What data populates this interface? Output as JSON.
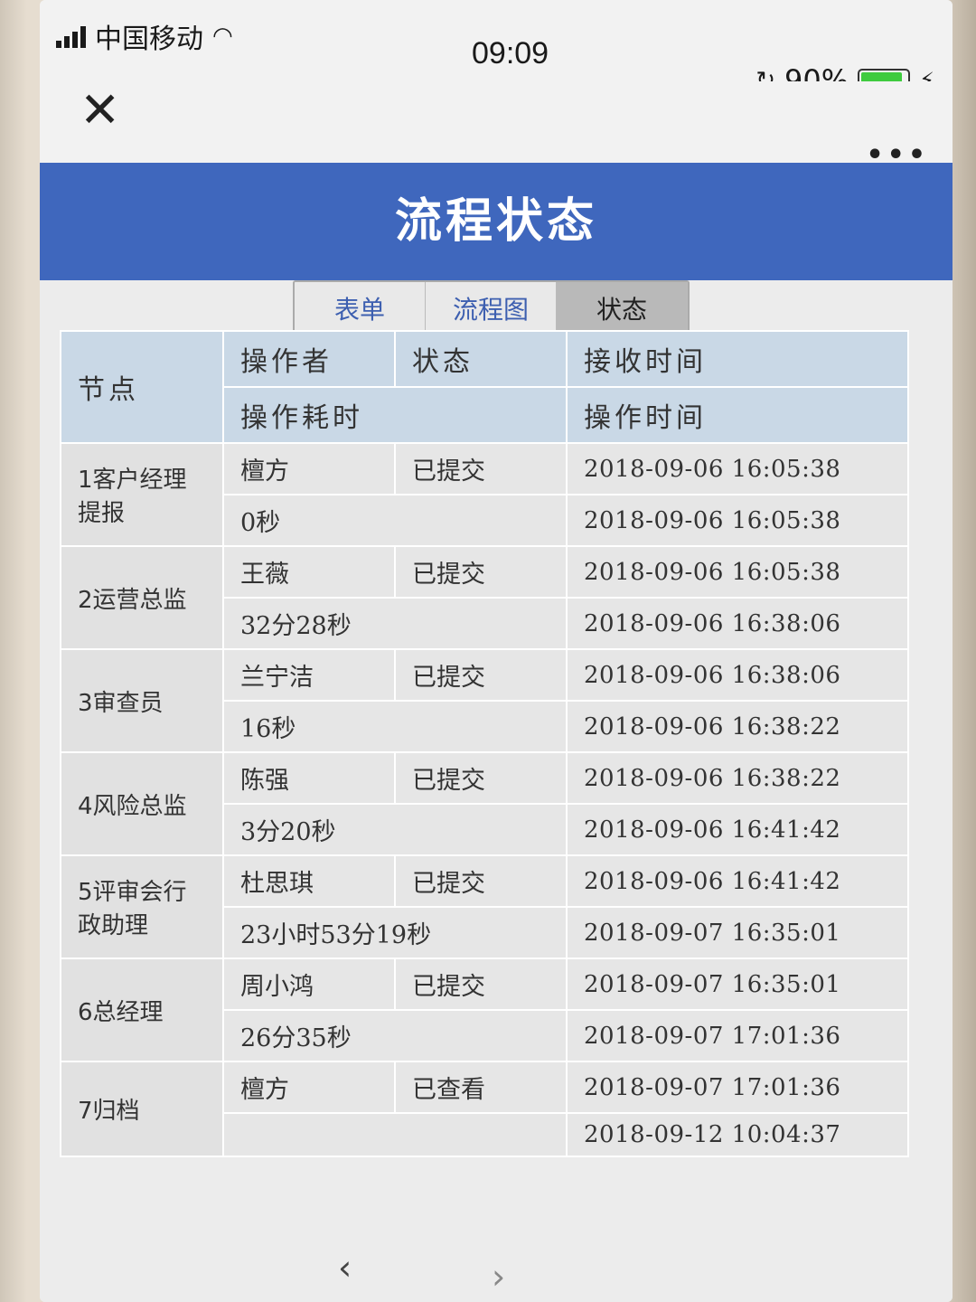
{
  "status_bar": {
    "carrier": "中国移动",
    "time": "09:09",
    "battery_percent": "90%",
    "battery_level": 0.9,
    "battery_color": "#3ecb3e"
  },
  "header": {
    "title": "流程状态",
    "bg_color": "#3f67bd"
  },
  "tabs": [
    {
      "label": "表单"
    },
    {
      "label": "流程图"
    },
    {
      "label": "状态",
      "active": true
    }
  ],
  "table": {
    "headers": {
      "node": "节点",
      "operator": "操作者",
      "status": "状态",
      "receive_time": "接收时间",
      "duration": "操作耗时",
      "operate_time": "操作时间"
    },
    "rows": [
      {
        "node": "1客户经理提报",
        "operator": "檀方",
        "status": "已提交",
        "receive_time": "2018-09-06 16:05:38",
        "duration": "0秒",
        "operate_time": "2018-09-06 16:05:38"
      },
      {
        "node": "2运营总监",
        "operator": "王薇",
        "status": "已提交",
        "receive_time": "2018-09-06 16:05:38",
        "duration": "32分28秒",
        "operate_time": "2018-09-06 16:38:06"
      },
      {
        "node": "3审查员",
        "operator": "兰宁洁",
        "status": "已提交",
        "receive_time": "2018-09-06 16:38:06",
        "duration": "16秒",
        "operate_time": "2018-09-06 16:38:22"
      },
      {
        "node": "4风险总监",
        "operator": "陈强",
        "status": "已提交",
        "receive_time": "2018-09-06 16:38:22",
        "duration": "3分20秒",
        "operate_time": "2018-09-06 16:41:42"
      },
      {
        "node": "5评审会行政助理",
        "operator": "杜思琪",
        "status": "已提交",
        "receive_time": "2018-09-06 16:41:42",
        "duration": "23小时53分19秒",
        "operate_time": "2018-09-07 16:35:01"
      },
      {
        "node": "6总经理",
        "operator": "周小鸿",
        "status": "已提交",
        "receive_time": "2018-09-07 16:35:01",
        "duration": "26分35秒",
        "operate_time": "2018-09-07 17:01:36"
      },
      {
        "node": "7归档",
        "operator": "檀方",
        "status": "已查看",
        "receive_time": "2018-09-07 17:01:36",
        "duration": "",
        "operate_time": "2018-09-12 10:04:37"
      }
    ]
  }
}
